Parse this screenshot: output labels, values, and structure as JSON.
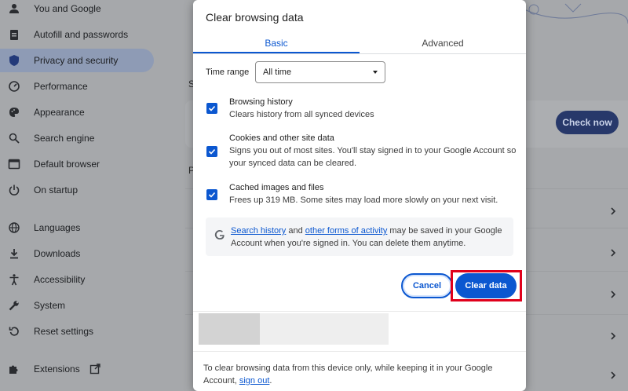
{
  "sidebar": {
    "items": [
      {
        "label": "You and Google",
        "icon": "person-icon"
      },
      {
        "label": "Autofill and passwords",
        "icon": "clipboard-icon"
      },
      {
        "label": "Privacy and security",
        "icon": "shield-icon",
        "active": true
      },
      {
        "label": "Performance",
        "icon": "gauge-icon"
      },
      {
        "label": "Appearance",
        "icon": "palette-icon"
      },
      {
        "label": "Search engine",
        "icon": "search-icon"
      },
      {
        "label": "Default browser",
        "icon": "browser-icon"
      },
      {
        "label": "On startup",
        "icon": "power-icon"
      },
      {
        "label": "Languages",
        "icon": "globe-icon"
      },
      {
        "label": "Downloads",
        "icon": "download-icon"
      },
      {
        "label": "Accessibility",
        "icon": "accessibility-icon"
      },
      {
        "label": "System",
        "icon": "wrench-icon"
      },
      {
        "label": "Reset settings",
        "icon": "reset-icon"
      },
      {
        "label": "Extensions",
        "icon": "puzzle-icon"
      }
    ]
  },
  "background": {
    "check_now_label": "Check now",
    "letter_s": "S",
    "letter_p": "P"
  },
  "dialog": {
    "title": "Clear browsing data",
    "tabs": [
      {
        "label": "Basic",
        "selected": true
      },
      {
        "label": "Advanced",
        "selected": false
      }
    ],
    "time_range": {
      "label": "Time range",
      "value": "All time"
    },
    "options": [
      {
        "title": "Browsing history",
        "description": "Clears history from all synced devices",
        "checked": true
      },
      {
        "title": "Cookies and other site data",
        "description": "Signs you out of most sites. You'll stay signed in to your Google Account so your synced data can be cleared.",
        "checked": true
      },
      {
        "title": "Cached images and files",
        "description": "Frees up 319 MB. Some sites may load more slowly on your next visit.",
        "checked": true
      }
    ],
    "info": {
      "link_search_history": "Search history",
      "text_and": " and ",
      "link_other_activity": "other forms of activity",
      "text_rest": " may be saved in your Google Account when you're signed in. You can delete them anytime."
    },
    "buttons": {
      "cancel": "Cancel",
      "clear": "Clear data"
    },
    "footer": {
      "text": "To clear browsing data from this device only, while keeping it in your Google Account, ",
      "link_sign_out": "sign out",
      "text_end": "."
    }
  },
  "colors": {
    "accent": "#0b57d0",
    "highlight": "#e0001b"
  }
}
